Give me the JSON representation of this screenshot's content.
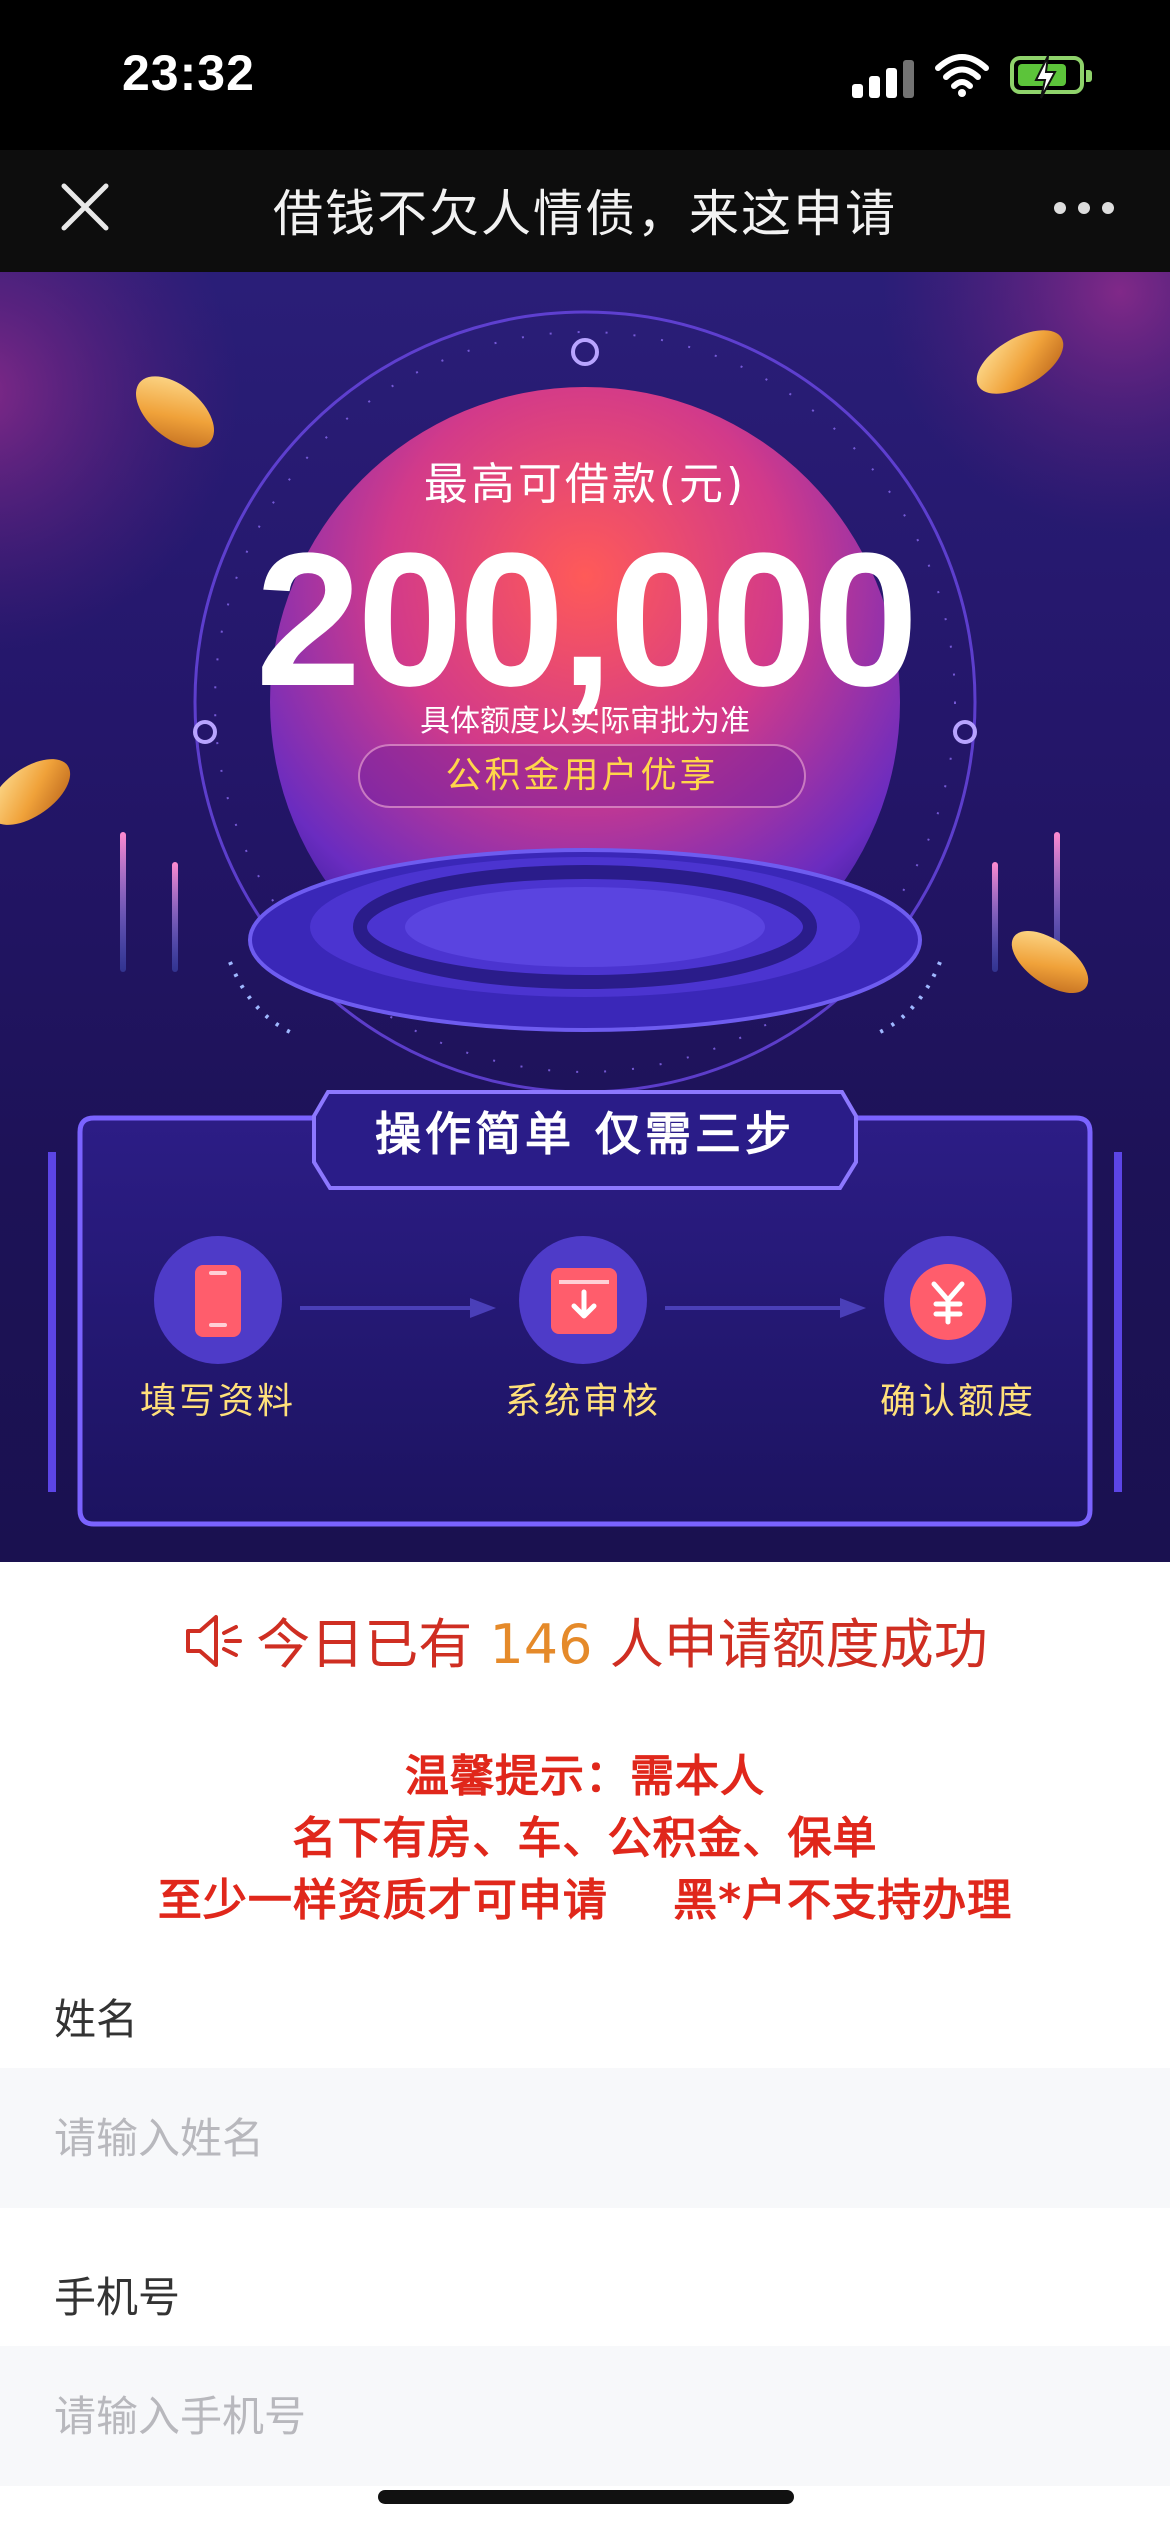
{
  "status_bar": {
    "time": "23:32"
  },
  "nav": {
    "title": "借钱不欠人情债，来这申请"
  },
  "banner": {
    "hero_label": "最高可借款(元)",
    "amount": "200,000",
    "note": "具体额度以实际审批为准",
    "pill": "公积金用户优享",
    "steps_title": "操作简单  仅需三步",
    "steps": [
      {
        "label": "填写资料",
        "icon": "phone-icon"
      },
      {
        "label": "系统审核",
        "icon": "download-box-icon"
      },
      {
        "label": "确认额度",
        "icon": "yen-icon"
      }
    ]
  },
  "ticker": {
    "prefix": "今日已有 ",
    "count": "146",
    "suffix": " 人申请额度成功"
  },
  "tips": [
    "温馨提示：需本人",
    "名下有房、车、公积金、保单",
    "至少一样资质才可申请    黑*户不支持办理"
  ],
  "form": {
    "name_label": "姓名",
    "name_placeholder": "请输入姓名",
    "phone_label": "手机号",
    "phone_placeholder": "请输入手机号"
  },
  "colors": {
    "banner_bg": "#24166a",
    "accent_red": "#e0271b",
    "count_orange": "#e58a2a",
    "pill_text": "#ffd64a"
  }
}
